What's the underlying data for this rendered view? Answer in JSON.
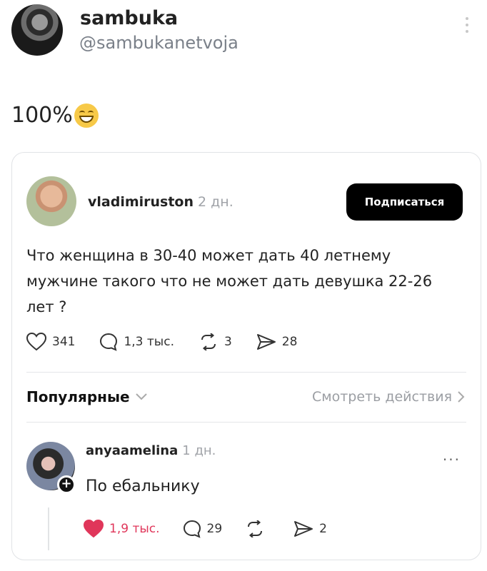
{
  "tweet": {
    "author_name": "sambuka",
    "author_handle": "@sambukanetvoja",
    "text": "100%",
    "emoji": "grin-emoji"
  },
  "embedded_post": {
    "username": "vladimiruston",
    "time": "2 дн.",
    "subscribe_label": "Подписаться",
    "body": "Что женщина в 30-40 может дать 40 летнему мужчине такого что не может дать девушка 22-26 лет ?",
    "stats": {
      "likes": "341",
      "comments": "1,3 тыс.",
      "reposts": "3",
      "shares": "28"
    },
    "sort_label": "Популярные",
    "view_actions_label": "Смотреть действия"
  },
  "reply": {
    "username": "anyaamelina",
    "time": "1 дн.",
    "text": "По ебальнику",
    "more": "...",
    "stats": {
      "likes": "1,9 тыс.",
      "comments": "29",
      "reposts": "",
      "shares": "2"
    },
    "like_color": "#e0365a"
  }
}
